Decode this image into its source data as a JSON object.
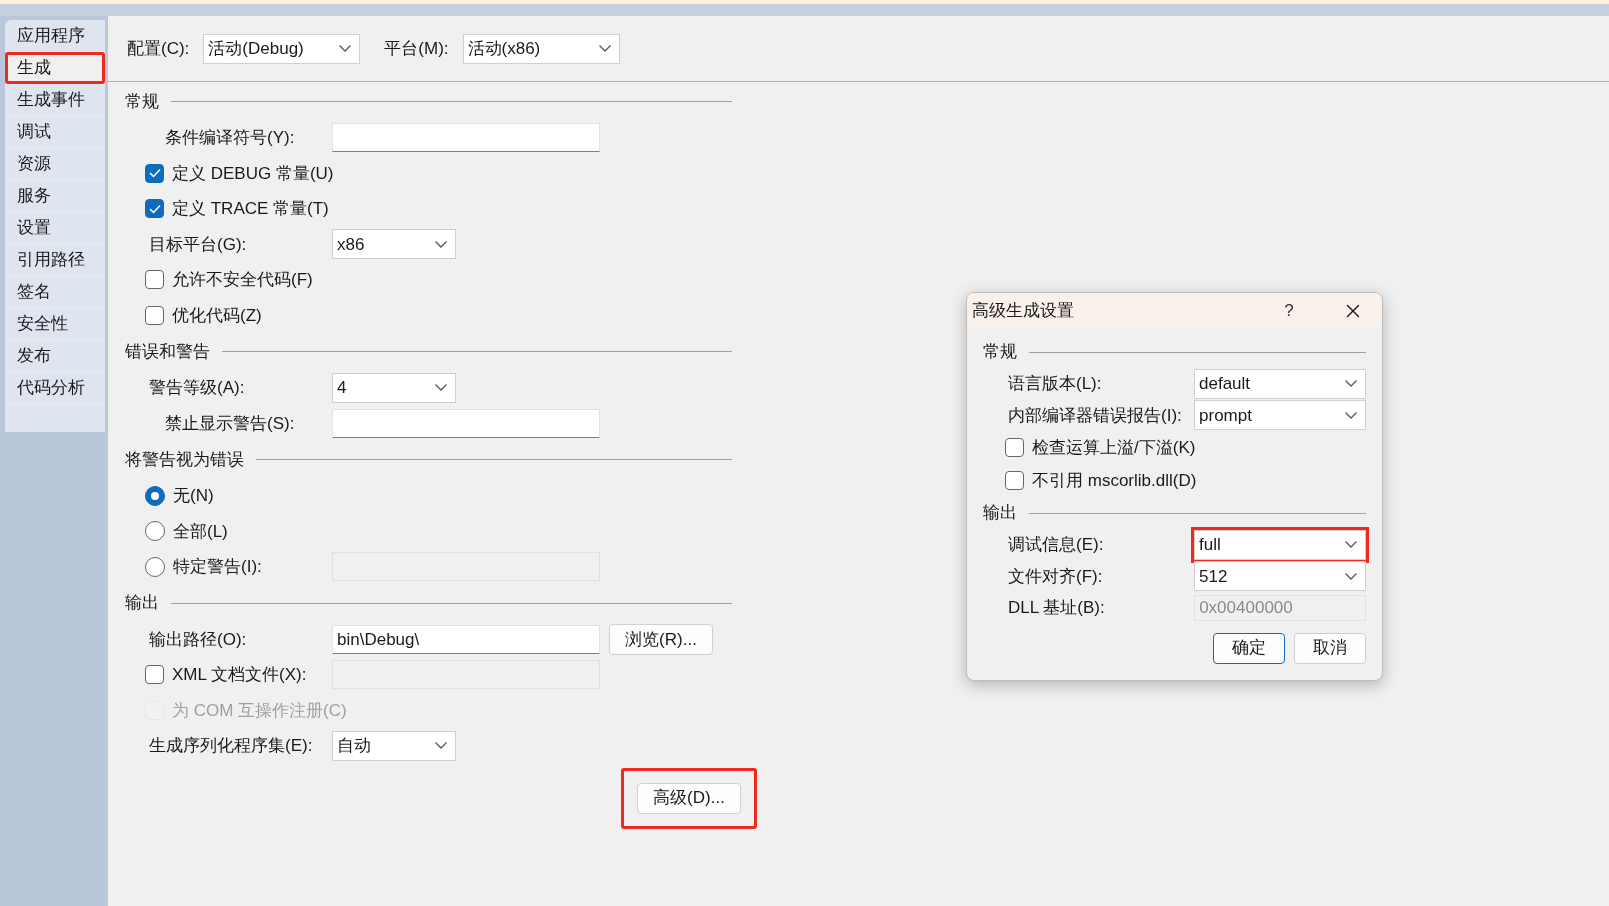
{
  "sidebar": {
    "items": [
      {
        "label": "应用程序",
        "selected": false,
        "highlighted": false
      },
      {
        "label": "生成",
        "selected": true,
        "highlighted": true
      },
      {
        "label": "生成事件",
        "selected": false,
        "highlighted": false
      },
      {
        "label": "调试",
        "selected": false,
        "highlighted": false
      },
      {
        "label": "资源",
        "selected": false,
        "highlighted": false
      },
      {
        "label": "服务",
        "selected": false,
        "highlighted": false
      },
      {
        "label": "设置",
        "selected": false,
        "highlighted": false
      },
      {
        "label": "引用路径",
        "selected": false,
        "highlighted": false
      },
      {
        "label": "签名",
        "selected": false,
        "highlighted": false
      },
      {
        "label": "安全性",
        "selected": false,
        "highlighted": false
      },
      {
        "label": "发布",
        "selected": false,
        "highlighted": false
      },
      {
        "label": "代码分析",
        "selected": false,
        "highlighted": false
      }
    ]
  },
  "toolbar": {
    "configuration": {
      "label": "配置(C):",
      "value": "活动(Debug)"
    },
    "platform": {
      "label": "平台(M):",
      "value": "活动(x86)"
    }
  },
  "sections": [
    {
      "title": "常规",
      "rows": [
        {
          "kind": "text",
          "label": "条件编译符号(Y):",
          "disabled": false
        },
        {
          "kind": "checkbox",
          "label": "定义 DEBUG 常量(U)",
          "checked": true,
          "disabled": false
        },
        {
          "kind": "checkbox",
          "label": "定义 TRACE 常量(T)",
          "checked": true,
          "disabled": false
        },
        {
          "kind": "select",
          "label": "目标平台(G):",
          "value": "x86"
        },
        {
          "kind": "checkbox",
          "label": "允许不安全代码(F)",
          "checked": false,
          "disabled": false
        },
        {
          "kind": "checkbox",
          "label": "优化代码(Z)",
          "checked": false,
          "disabled": false
        }
      ]
    },
    {
      "title": "错误和警告",
      "rows": [
        {
          "kind": "select",
          "label": "警告等级(A):",
          "value": "4"
        },
        {
          "kind": "text",
          "label": "禁止显示警告(S):",
          "disabled": false
        }
      ]
    },
    {
      "title": "将警告视为错误",
      "rows": [
        {
          "kind": "radio",
          "label": "无(N)",
          "selected": true
        },
        {
          "kind": "radio",
          "label": "全部(L)",
          "selected": false
        },
        {
          "kind": "radio",
          "label": "特定警告(I):",
          "selected": false,
          "field": {
            "disabled": true
          }
        }
      ]
    },
    {
      "title": "输出",
      "rows": [
        {
          "kind": "path",
          "label": "输出路径(O):",
          "value": "bin\\Debug\\",
          "button": "浏览(R)..."
        },
        {
          "kind": "checkbox",
          "label": "XML 文档文件(X):",
          "checked": false,
          "disabled": false,
          "field": {
            "disabled": true
          }
        },
        {
          "kind": "checkbox",
          "label": "为 COM 互操作注册(C)",
          "checked": false,
          "disabled": true
        },
        {
          "kind": "select",
          "label": "生成序列化程序集(E):",
          "value": "自动"
        }
      ]
    }
  ],
  "advanced_button": {
    "label": "高级(D)...",
    "highlighted": true
  },
  "dialog": {
    "title": "高级生成设置",
    "help": "?",
    "sections": [
      {
        "title": "常规",
        "rows": [
          {
            "kind": "select",
            "label": "语言版本(L):",
            "value": "default",
            "highlighted": false
          },
          {
            "kind": "select",
            "label": "内部编译器错误报告(I):",
            "value": "prompt",
            "highlighted": false
          },
          {
            "kind": "checkbox",
            "label": "检查运算上溢/下溢(K)",
            "checked": false
          },
          {
            "kind": "checkbox",
            "label": "不引用 mscorlib.dll(D)",
            "checked": false
          }
        ]
      },
      {
        "title": "输出",
        "rows": [
          {
            "kind": "select",
            "label": "调试信息(E):",
            "value": "full",
            "highlighted": true
          },
          {
            "kind": "select",
            "label": "文件对齐(F):",
            "value": "512",
            "highlighted": false
          },
          {
            "kind": "readonly",
            "label": "DLL 基址(B):",
            "value": "0x00400000"
          }
        ]
      }
    ],
    "buttons": [
      {
        "label": "确定",
        "default": true
      },
      {
        "label": "取消",
        "default": false
      }
    ]
  }
}
